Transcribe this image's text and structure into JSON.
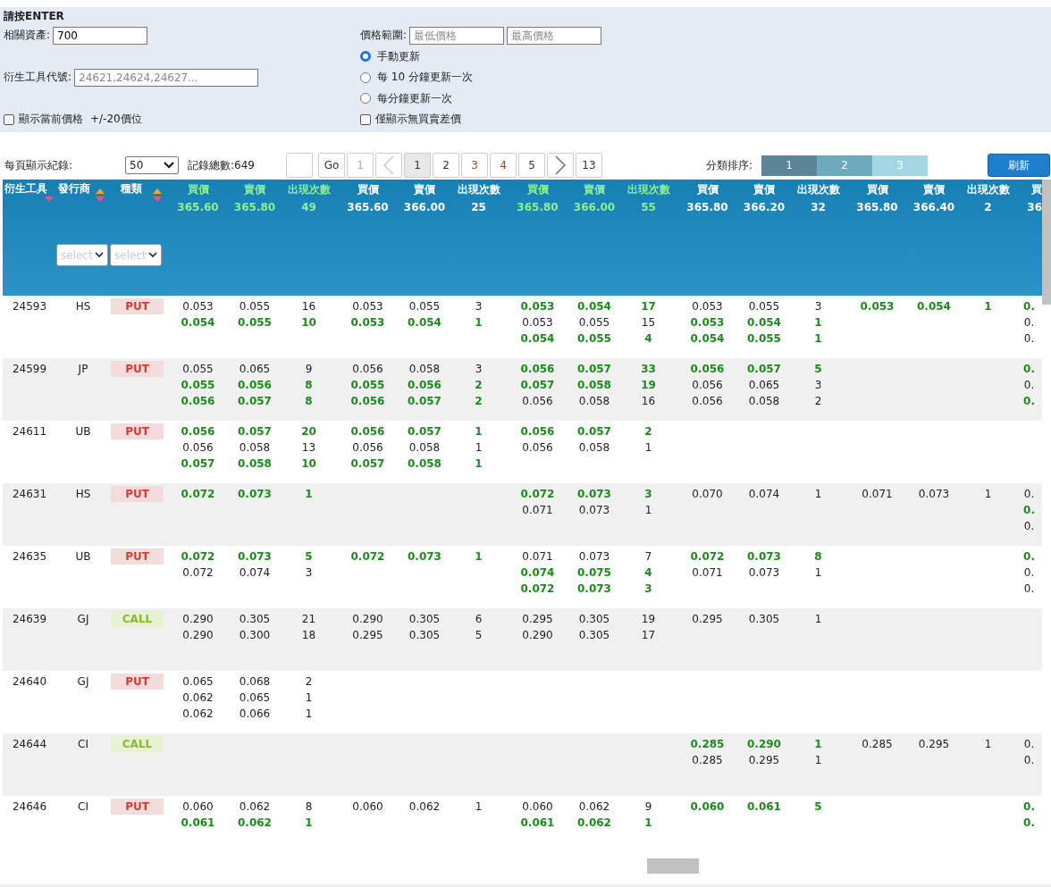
{
  "filter": {
    "title": "請按ENTER",
    "asset": {
      "label": "相關資產:",
      "value": "700"
    },
    "code": {
      "label": "衍生工具代號:",
      "placeholder": "24621,24624,24627..."
    },
    "show_near": {
      "label": "顯示當前價格",
      "extra": "+/-20價位",
      "checked": false
    },
    "price_range": {
      "label": "價格範圍:",
      "min_placeholder": "最低價格",
      "max_placeholder": "最高價格"
    },
    "refresh_modes": [
      {
        "label": "手動更新",
        "selected": true
      },
      {
        "label": "每 10 分鐘更新一次",
        "selected": false
      },
      {
        "label": "每分鐘更新一次",
        "selected": false
      }
    ],
    "no_spread": {
      "label": "僅顯示無買賣差價",
      "checked": false
    }
  },
  "pager": {
    "per_page_label": "每頁顯示紀錄:",
    "per_page": "50",
    "total": "記錄總數:649",
    "items": [
      {
        "kind": "input"
      },
      {
        "kind": "go",
        "label": "Go",
        "disabled": false
      },
      {
        "kind": "page",
        "label": "1",
        "selected": false,
        "disabled": true,
        "visited": false
      },
      {
        "kind": "prev",
        "disabled": true
      },
      {
        "kind": "page",
        "label": "1",
        "selected": true,
        "disabled": false,
        "visited": false
      },
      {
        "kind": "page",
        "label": "2",
        "selected": false,
        "disabled": false,
        "visited": false
      },
      {
        "kind": "page",
        "label": "3",
        "selected": false,
        "disabled": false,
        "visited": true
      },
      {
        "kind": "page",
        "label": "4",
        "selected": false,
        "disabled": false,
        "visited": true
      },
      {
        "kind": "page",
        "label": "5",
        "selected": false,
        "disabled": false,
        "visited": false
      },
      {
        "kind": "next",
        "disabled": false
      },
      {
        "kind": "page",
        "label": "13",
        "selected": false,
        "disabled": false,
        "visited": false
      }
    ],
    "sort_label": "分類排序:",
    "sort_levels": [
      {
        "label": "1",
        "color": "#5d8598"
      },
      {
        "label": "2",
        "color": "#6eaabd"
      },
      {
        "label": "3",
        "color": "#a2d6e2"
      }
    ],
    "refresh_button": "刷新"
  },
  "table": {
    "columns": [
      {
        "label": "衍生工具",
        "up_arrow": false,
        "down_arrow": true
      },
      {
        "label": "發行商",
        "up_arrow": true,
        "down_arrow": true
      },
      {
        "label": "種類",
        "up_arrow": true,
        "down_arrow": true
      }
    ],
    "filters": [
      "select",
      "select"
    ],
    "groups": [
      {
        "bid_label": "買價",
        "ask_label": "賣價",
        "count_label": "出現次數",
        "bid": "365.60",
        "ask": "365.80",
        "count": "49",
        "highlighted": true
      },
      {
        "bid_label": "買價",
        "ask_label": "賣價",
        "count_label": "出現次數",
        "bid": "365.60",
        "ask": "366.00",
        "count": "25",
        "highlighted": false
      },
      {
        "bid_label": "買價",
        "ask_label": "賣價",
        "count_label": "出現次數",
        "bid": "365.80",
        "ask": "366.00",
        "count": "55",
        "highlighted": true
      },
      {
        "bid_label": "買價",
        "ask_label": "賣價",
        "count_label": "出現次數",
        "bid": "365.80",
        "ask": "366.20",
        "count": "32",
        "highlighted": false
      },
      {
        "bid_label": "買價",
        "ask_label": "賣價",
        "count_label": "出現次數",
        "bid": "365.80",
        "ask": "366.40",
        "count": "2",
        "highlighted": false
      }
    ],
    "partial_group": {
      "label": "買",
      "value": "36"
    },
    "rows": [
      {
        "code": "24593",
        "issuer": "HS",
        "type": "PUT",
        "kind": "put",
        "quotes": {
          "group_1": [
            {
              "bid": "0.053",
              "ask": "0.055",
              "count": "16",
              "best": false
            },
            {
              "bid": "0.054",
              "ask": "0.055",
              "count": "10",
              "best": true
            }
          ],
          "group_2": [
            {
              "bid": "0.053",
              "ask": "0.055",
              "count": "3",
              "best": false
            },
            {
              "bid": "0.053",
              "ask": "0.054",
              "count": "1",
              "best": true
            }
          ],
          "group_3": [
            {
              "bid": "0.053",
              "ask": "0.054",
              "count": "17",
              "best": true
            },
            {
              "bid": "0.053",
              "ask": "0.055",
              "count": "15",
              "best": false
            },
            {
              "bid": "0.054",
              "ask": "0.055",
              "count": "4",
              "best": true
            }
          ],
          "group_4": [
            {
              "bid": "0.053",
              "ask": "0.055",
              "count": "3",
              "best": false
            },
            {
              "bid": "0.053",
              "ask": "0.054",
              "count": "1",
              "best": true
            },
            {
              "bid": "0.054",
              "ask": "0.055",
              "count": "1",
              "best": true
            }
          ],
          "group_5": [
            {
              "bid": "0.053",
              "ask": "0.054",
              "count": "1",
              "best": true
            }
          ]
        },
        "partial": [
          {
            "text": "0.",
            "best": true
          },
          {
            "text": "0.",
            "best": false
          },
          {
            "text": "0.",
            "best": false
          }
        ]
      },
      {
        "code": "24599",
        "issuer": "JP",
        "type": "PUT",
        "kind": "put",
        "quotes": {
          "group_1": [
            {
              "bid": "0.055",
              "ask": "0.065",
              "count": "9",
              "best": false
            },
            {
              "bid": "0.055",
              "ask": "0.056",
              "count": "8",
              "best": true
            },
            {
              "bid": "0.056",
              "ask": "0.057",
              "count": "8",
              "best": true
            }
          ],
          "group_2": [
            {
              "bid": "0.056",
              "ask": "0.058",
              "count": "3",
              "best": false
            },
            {
              "bid": "0.055",
              "ask": "0.056",
              "count": "2",
              "best": true
            },
            {
              "bid": "0.056",
              "ask": "0.057",
              "count": "2",
              "best": true
            }
          ],
          "group_3": [
            {
              "bid": "0.056",
              "ask": "0.057",
              "count": "33",
              "best": true
            },
            {
              "bid": "0.057",
              "ask": "0.058",
              "count": "19",
              "best": true
            },
            {
              "bid": "0.056",
              "ask": "0.058",
              "count": "16",
              "best": false
            }
          ],
          "group_4": [
            {
              "bid": "0.056",
              "ask": "0.057",
              "count": "5",
              "best": true
            },
            {
              "bid": "0.056",
              "ask": "0.065",
              "count": "3",
              "best": false
            },
            {
              "bid": "0.056",
              "ask": "0.058",
              "count": "2",
              "best": false
            }
          ]
        },
        "partial": [
          {
            "text": "0.",
            "best": true
          },
          {
            "text": "0.",
            "best": false
          },
          {
            "text": "0.",
            "best": true
          }
        ]
      },
      {
        "code": "24611",
        "issuer": "UB",
        "type": "PUT",
        "kind": "put",
        "quotes": {
          "group_1": [
            {
              "bid": "0.056",
              "ask": "0.057",
              "count": "20",
              "best": true
            },
            {
              "bid": "0.056",
              "ask": "0.058",
              "count": "13",
              "best": false
            },
            {
              "bid": "0.057",
              "ask": "0.058",
              "count": "10",
              "best": true
            }
          ],
          "group_2": [
            {
              "bid": "0.056",
              "ask": "0.057",
              "count": "1",
              "best": true
            },
            {
              "bid": "0.056",
              "ask": "0.058",
              "count": "1",
              "best": false
            },
            {
              "bid": "0.057",
              "ask": "0.058",
              "count": "1",
              "best": true
            }
          ],
          "group_3": [
            {
              "bid": "0.056",
              "ask": "0.057",
              "count": "2",
              "best": true
            },
            {
              "bid": "0.056",
              "ask": "0.058",
              "count": "1",
              "best": false
            }
          ]
        }
      },
      {
        "code": "24631",
        "issuer": "HS",
        "type": "PUT",
        "kind": "put",
        "quotes": {
          "group_1": [
            {
              "bid": "0.072",
              "ask": "0.073",
              "count": "1",
              "best": true
            }
          ],
          "group_3": [
            {
              "bid": "0.072",
              "ask": "0.073",
              "count": "3",
              "best": true
            },
            {
              "bid": "0.071",
              "ask": "0.073",
              "count": "1",
              "best": false
            }
          ],
          "group_4": [
            {
              "bid": "0.070",
              "ask": "0.074",
              "count": "1",
              "best": false
            }
          ],
          "group_5": [
            {
              "bid": "0.071",
              "ask": "0.073",
              "count": "1",
              "best": false
            }
          ]
        },
        "partial": [
          {
            "text": "0.",
            "best": false
          },
          {
            "text": "0.",
            "best": true
          },
          {
            "text": "0.",
            "best": false
          }
        ]
      },
      {
        "code": "24635",
        "issuer": "UB",
        "type": "PUT",
        "kind": "put",
        "quotes": {
          "group_1": [
            {
              "bid": "0.072",
              "ask": "0.073",
              "count": "5",
              "best": true
            },
            {
              "bid": "0.072",
              "ask": "0.074",
              "count": "3",
              "best": false
            }
          ],
          "group_2": [
            {
              "bid": "0.072",
              "ask": "0.073",
              "count": "1",
              "best": true
            }
          ],
          "group_3": [
            {
              "bid": "0.071",
              "ask": "0.073",
              "count": "7",
              "best": false
            },
            {
              "bid": "0.074",
              "ask": "0.075",
              "count": "4",
              "best": true
            },
            {
              "bid": "0.072",
              "ask": "0.073",
              "count": "3",
              "best": true
            }
          ],
          "group_4": [
            {
              "bid": "0.072",
              "ask": "0.073",
              "count": "8",
              "best": true
            },
            {
              "bid": "0.071",
              "ask": "0.073",
              "count": "1",
              "best": false
            }
          ]
        },
        "partial": [
          {
            "text": "0.",
            "best": true
          },
          {
            "text": "0.",
            "best": false
          },
          {
            "text": "0.",
            "best": false
          }
        ]
      },
      {
        "code": "24639",
        "issuer": "GJ",
        "type": "CALL",
        "kind": "call",
        "quotes": {
          "group_1": [
            {
              "bid": "0.290",
              "ask": "0.305",
              "count": "21",
              "best": false
            },
            {
              "bid": "0.290",
              "ask": "0.300",
              "count": "18",
              "best": false
            }
          ],
          "group_2": [
            {
              "bid": "0.290",
              "ask": "0.305",
              "count": "6",
              "best": false
            },
            {
              "bid": "0.295",
              "ask": "0.305",
              "count": "5",
              "best": false
            }
          ],
          "group_3": [
            {
              "bid": "0.295",
              "ask": "0.305",
              "count": "19",
              "best": false
            },
            {
              "bid": "0.290",
              "ask": "0.305",
              "count": "17",
              "best": false
            }
          ],
          "group_4": [
            {
              "bid": "0.295",
              "ask": "0.305",
              "count": "1",
              "best": false
            }
          ]
        }
      },
      {
        "code": "24640",
        "issuer": "GJ",
        "type": "PUT",
        "kind": "put",
        "quotes": {
          "group_1": [
            {
              "bid": "0.065",
              "ask": "0.068",
              "count": "2",
              "best": false
            },
            {
              "bid": "0.062",
              "ask": "0.065",
              "count": "1",
              "best": false
            },
            {
              "bid": "0.062",
              "ask": "0.066",
              "count": "1",
              "best": false
            }
          ]
        }
      },
      {
        "code": "24644",
        "issuer": "CI",
        "type": "CALL",
        "kind": "call",
        "quotes": {
          "group_4": [
            {
              "bid": "0.285",
              "ask": "0.290",
              "count": "1",
              "best": true
            },
            {
              "bid": "0.285",
              "ask": "0.295",
              "count": "1",
              "best": false
            }
          ],
          "group_5": [
            {
              "bid": "0.285",
              "ask": "0.295",
              "count": "1",
              "best": false
            }
          ]
        },
        "partial": [
          {
            "text": "0.",
            "best": false
          },
          {
            "text": "0.",
            "best": false
          }
        ]
      },
      {
        "code": "24646",
        "issuer": "CI",
        "type": "PUT",
        "kind": "put",
        "quotes": {
          "group_1": [
            {
              "bid": "0.060",
              "ask": "0.062",
              "count": "8",
              "best": false
            },
            {
              "bid": "0.061",
              "ask": "0.062",
              "count": "1",
              "best": true
            }
          ],
          "group_2": [
            {
              "bid": "0.060",
              "ask": "0.062",
              "count": "1",
              "best": false
            }
          ],
          "group_3": [
            {
              "bid": "0.060",
              "ask": "0.062",
              "count": "9",
              "best": false
            },
            {
              "bid": "0.061",
              "ask": "0.062",
              "count": "1",
              "best": true
            }
          ],
          "group_4": [
            {
              "bid": "0.060",
              "ask": "0.061",
              "count": "5",
              "best": true
            }
          ]
        },
        "partial": [
          {
            "text": "0.",
            "best": true
          },
          {
            "text": "0.",
            "best": true
          }
        ]
      }
    ]
  }
}
